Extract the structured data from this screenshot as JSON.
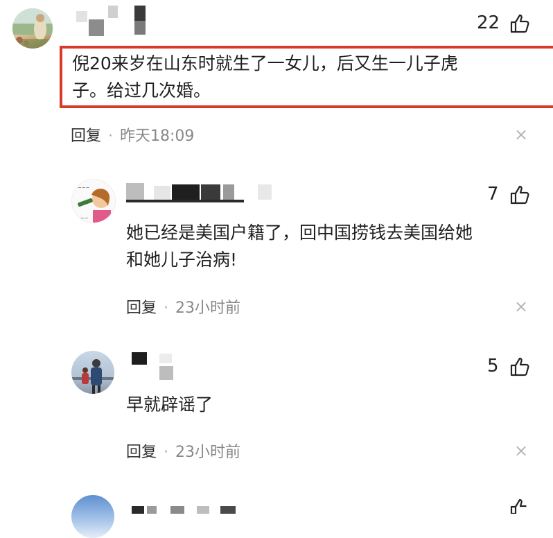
{
  "comments": [
    {
      "likes": "22",
      "text_line1": "倪20来岁在山东时就生了一女儿，后又生一儿子虎",
      "text_line2": "子。给过几次婚。",
      "reply_label": "回复",
      "time": "昨天18:09",
      "highlighted": true
    },
    {
      "likes": "7",
      "text_line1": "她已经是美国户籍了，回中国捞钱去美国给她",
      "text_line2": "和她儿子治病!",
      "reply_label": "回复",
      "time": "23小时前"
    },
    {
      "likes": "5",
      "text_line1": "早就辟谣了",
      "reply_label": "回复",
      "time": "23小时前"
    }
  ],
  "colors": {
    "highlight": "#d83a2a",
    "meta_gray": "#888888"
  },
  "icons": {
    "like": "thumbs-up-icon",
    "close": "close-icon",
    "separator": "dot"
  },
  "separator_char": "·",
  "close_char": "×"
}
